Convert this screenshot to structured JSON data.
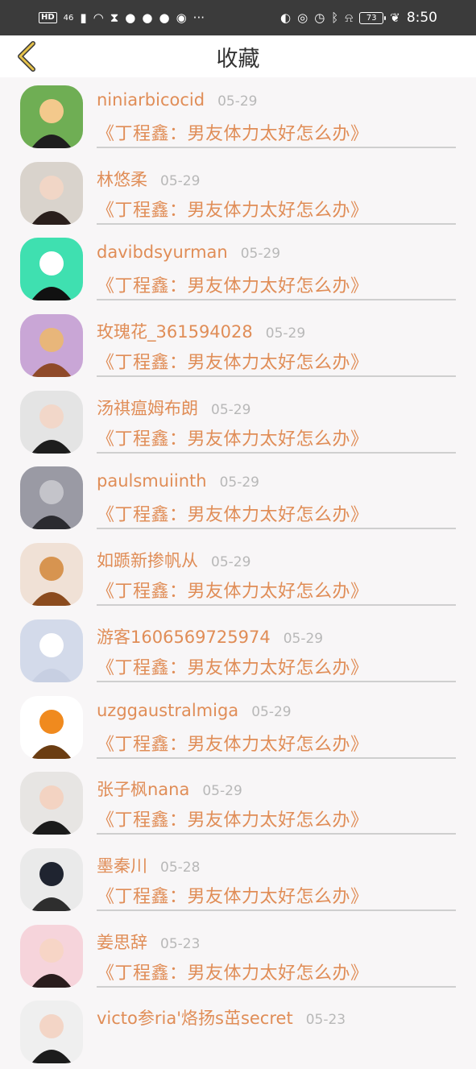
{
  "status_bar": {
    "left_chips": [
      "HD",
      "46"
    ],
    "ellipsis": "···",
    "battery": "73",
    "time": "8:50"
  },
  "header": {
    "title": "收藏"
  },
  "favorites": [
    {
      "name": "niniarbicocid",
      "date": "05-29",
      "article": "《丁程鑫：男友体力太好怎么办》"
    },
    {
      "name": "林悠柔",
      "date": "05-29",
      "article": "《丁程鑫：男友体力太好怎么办》"
    },
    {
      "name": "davibdsyurman",
      "date": "05-29",
      "article": "《丁程鑫：男友体力太好怎么办》"
    },
    {
      "name": "玫瑰花_361594028",
      "date": "05-29",
      "article": "《丁程鑫：男友体力太好怎么办》"
    },
    {
      "name": "汤祺瘟姆布朗",
      "date": "05-29",
      "article": "《丁程鑫：男友体力太好怎么办》"
    },
    {
      "name": "paulsmuiinth",
      "date": "05-29",
      "article": "《丁程鑫：男友体力太好怎么办》"
    },
    {
      "name": "如踬新掺帆从",
      "date": "05-29",
      "article": "《丁程鑫：男友体力太好怎么办》"
    },
    {
      "name": "游客1606569725974",
      "date": "05-29",
      "article": "《丁程鑫：男友体力太好怎么办》"
    },
    {
      "name": "uzggaustralmiga",
      "date": "05-29",
      "article": "《丁程鑫：男友体力太好怎么办》"
    },
    {
      "name": "张子枫nana",
      "date": "05-29",
      "article": "《丁程鑫：男友体力太好怎么办》"
    },
    {
      "name": "墨秦川",
      "date": "05-28",
      "article": "《丁程鑫：男友体力太好怎么办》"
    },
    {
      "name": "姜思辞",
      "date": "05-23",
      "article": "《丁程鑫：男友体力太好怎么办》"
    },
    {
      "name": "victo参ria'烙扬s茁secret",
      "date": "05-23",
      "article": ""
    }
  ],
  "colors": {
    "accent": "#e08d57",
    "date": "#b8b8b8",
    "background": "#f8f6f7",
    "status_bar": "#3b3b3b",
    "back_arrow": "#d8b43a"
  }
}
